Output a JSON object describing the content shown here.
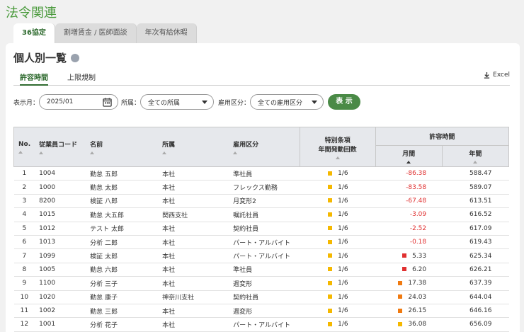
{
  "app_title": "法令関連",
  "tabs": [
    {
      "label": "36協定"
    },
    {
      "label": "割増賃金 / 医師面談"
    },
    {
      "label": "年次有給休暇"
    }
  ],
  "page_title": "個人別一覧",
  "subtabs": [
    {
      "label": "許容時間"
    },
    {
      "label": "上限規制"
    }
  ],
  "excel_label": "Excel",
  "filters": {
    "month_label": "表示月：",
    "month_value": "2025/01",
    "dept_label": "所属：",
    "dept_value": "全ての所属",
    "emptype_label": "雇用区分：",
    "emptype_value": "全ての雇用区分",
    "show_button": "表 示"
  },
  "columns": {
    "no": "No.",
    "code": "従業員コード",
    "name": "名前",
    "dept": "所属",
    "emptype": "雇用区分",
    "special_1": "特別条項",
    "special_2": "年間発動回数",
    "allow": "許容時間",
    "monthly": "月間",
    "yearly": "年間"
  },
  "colors": {
    "yellow": "#f5b800",
    "red": "#e03030",
    "orange": "#f07a10"
  },
  "rows": [
    {
      "no": "1",
      "code": "1004",
      "name": "勤怠 五郎",
      "dept": "本社",
      "emptype": "準社員",
      "count": "1/6",
      "monthly": "-86.38",
      "yearly": "588.47",
      "flag": "none"
    },
    {
      "no": "2",
      "code": "1000",
      "name": "勤怠 太郎",
      "dept": "本社",
      "emptype": "フレックス勤務",
      "count": "1/6",
      "monthly": "-83.58",
      "yearly": "589.07",
      "flag": "none"
    },
    {
      "no": "3",
      "code": "8200",
      "name": "検証 八郎",
      "dept": "本社",
      "emptype": "月変形2",
      "count": "1/6",
      "monthly": "-67.48",
      "yearly": "613.51",
      "flag": "none"
    },
    {
      "no": "4",
      "code": "1015",
      "name": "勤怠 大五郎",
      "dept": "関西支社",
      "emptype": "嘱託社員",
      "count": "1/6",
      "monthly": "-3.09",
      "yearly": "616.52",
      "flag": "none"
    },
    {
      "no": "5",
      "code": "1012",
      "name": "テスト 太郎",
      "dept": "本社",
      "emptype": "契約社員",
      "count": "1/6",
      "monthly": "-2.52",
      "yearly": "617.09",
      "flag": "none"
    },
    {
      "no": "6",
      "code": "1013",
      "name": "分析 二郎",
      "dept": "本社",
      "emptype": "パート・アルバイト",
      "count": "1/6",
      "monthly": "-0.18",
      "yearly": "619.43",
      "flag": "none"
    },
    {
      "no": "7",
      "code": "1099",
      "name": "検証 太郎",
      "dept": "本社",
      "emptype": "パート・アルバイト",
      "count": "1/6",
      "monthly": "5.33",
      "yearly": "625.34",
      "flag": "red"
    },
    {
      "no": "8",
      "code": "1005",
      "name": "勤怠 六郎",
      "dept": "本社",
      "emptype": "準社員",
      "count": "1/6",
      "monthly": "6.20",
      "yearly": "626.21",
      "flag": "red"
    },
    {
      "no": "9",
      "code": "1100",
      "name": "分析 三子",
      "dept": "本社",
      "emptype": "週変形",
      "count": "1/6",
      "monthly": "17.38",
      "yearly": "637.39",
      "flag": "orange"
    },
    {
      "no": "10",
      "code": "1020",
      "name": "勤怠 康子",
      "dept": "神奈川支社",
      "emptype": "契約社員",
      "count": "1/6",
      "monthly": "24.03",
      "yearly": "644.04",
      "flag": "orange"
    },
    {
      "no": "11",
      "code": "1002",
      "name": "勤怠 三郎",
      "dept": "本社",
      "emptype": "週変形",
      "count": "1/6",
      "monthly": "26.15",
      "yearly": "646.16",
      "flag": "orange"
    },
    {
      "no": "12",
      "code": "1001",
      "name": "分析 花子",
      "dept": "本社",
      "emptype": "パート・アルバイト",
      "count": "1/6",
      "monthly": "36.08",
      "yearly": "656.09",
      "flag": "yellow"
    }
  ]
}
